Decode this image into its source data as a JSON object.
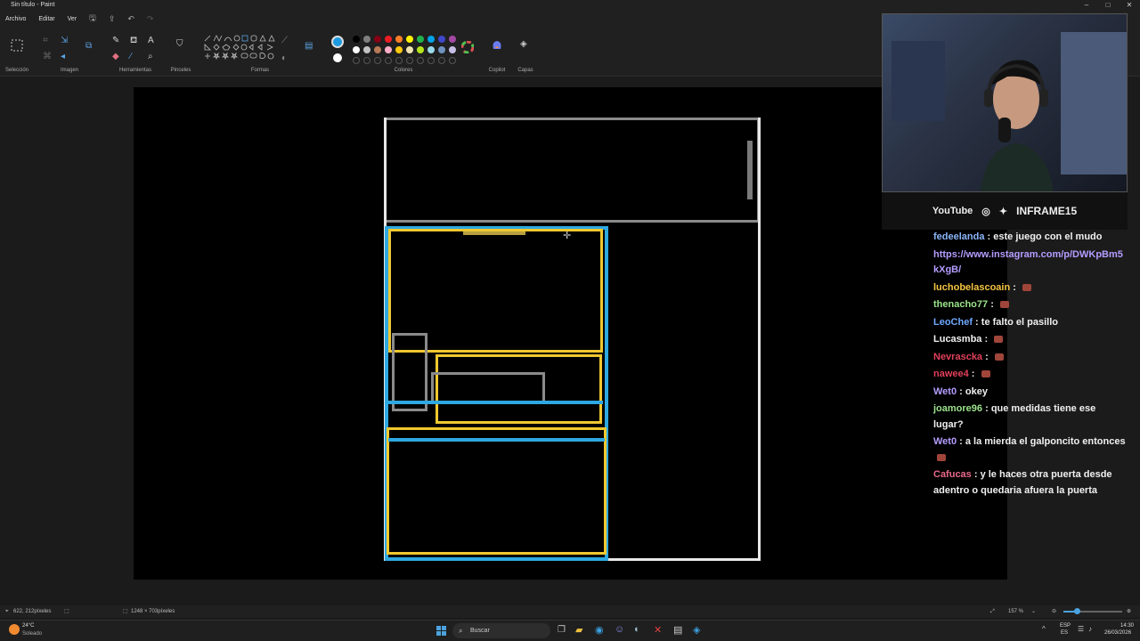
{
  "window": {
    "title": "Sin título - Paint",
    "controls": [
      "–",
      "□",
      "✕"
    ]
  },
  "menu": {
    "items": [
      "Archivo",
      "Editar",
      "Ver"
    ]
  },
  "ribbon": {
    "groups": {
      "seleccion": "Selección",
      "imagen": "Imagen",
      "herramientas": "Herramientas",
      "pinceles": "Pinceles",
      "formas": "Formas",
      "colores": "Colores",
      "copilot": "Copilot",
      "capas": "Capas"
    },
    "palette_row1": [
      "#000000",
      "#7f7f7f",
      "#880015",
      "#ed1c24",
      "#ff7f27",
      "#fff200",
      "#22b14c",
      "#00a2e8",
      "#3f48cc",
      "#a349a4"
    ],
    "palette_row2": [
      "#ffffff",
      "#c3c3c3",
      "#b97a57",
      "#ffaec9",
      "#ffc90e",
      "#efe4b0",
      "#b5e61d",
      "#99d9ea",
      "#7092be",
      "#c8bfe7"
    ],
    "active_color": "#1e9be0"
  },
  "status": {
    "cursor_pos": "622, 212píxeles",
    "canvas_size": "1248 × 703píxeles",
    "zoom": "157 %"
  },
  "taskbar": {
    "weather_temp": "24°C",
    "weather_desc": "Soleado",
    "search_placeholder": "Buscar",
    "lang": "ESP",
    "lang2": "ES",
    "time": "14:30",
    "date": "26/03/2026"
  },
  "stream": {
    "brand_youtube": "YouTube",
    "channel": "INFRAME15"
  },
  "chat": [
    {
      "user": "fedeelanda",
      "color": "#8ab4f8",
      "text": "este juego con el mudo"
    },
    {
      "user": "",
      "color": "#b49cff",
      "text": "https://www.instagram.com/p/DWKpBm5kXgB/"
    },
    {
      "user": "luchobelascoain",
      "color": "#f5c542",
      "text": ""
    },
    {
      "user": "thenacho77",
      "color": "#9be38b",
      "text": ""
    },
    {
      "user": "LeoChef",
      "color": "#6fa8ff",
      "text": "te falto el pasillo"
    },
    {
      "user": "Lucasmba",
      "color": "#f0f0f0",
      "text": ""
    },
    {
      "user": "Nevrascka",
      "color": "#e0405a",
      "text": ""
    },
    {
      "user": "nawee4",
      "color": "#e0405a",
      "text": ""
    },
    {
      "user": "Wet0",
      "color": "#b49cff",
      "text": "okey"
    },
    {
      "user": "joamore96",
      "color": "#9be38b",
      "text": "que medidas tiene ese lugar?"
    },
    {
      "user": "Wet0",
      "color": "#b49cff",
      "text": "a la mierda el galponcito entonces"
    },
    {
      "user": "Cafucas",
      "color": "#e86a8a",
      "text": "y le haces otra puerta desde adentro o quedaria afuera la puerta"
    }
  ],
  "chat_emote_flags": [
    false,
    false,
    true,
    true,
    false,
    true,
    true,
    true,
    false,
    false,
    true,
    false
  ]
}
